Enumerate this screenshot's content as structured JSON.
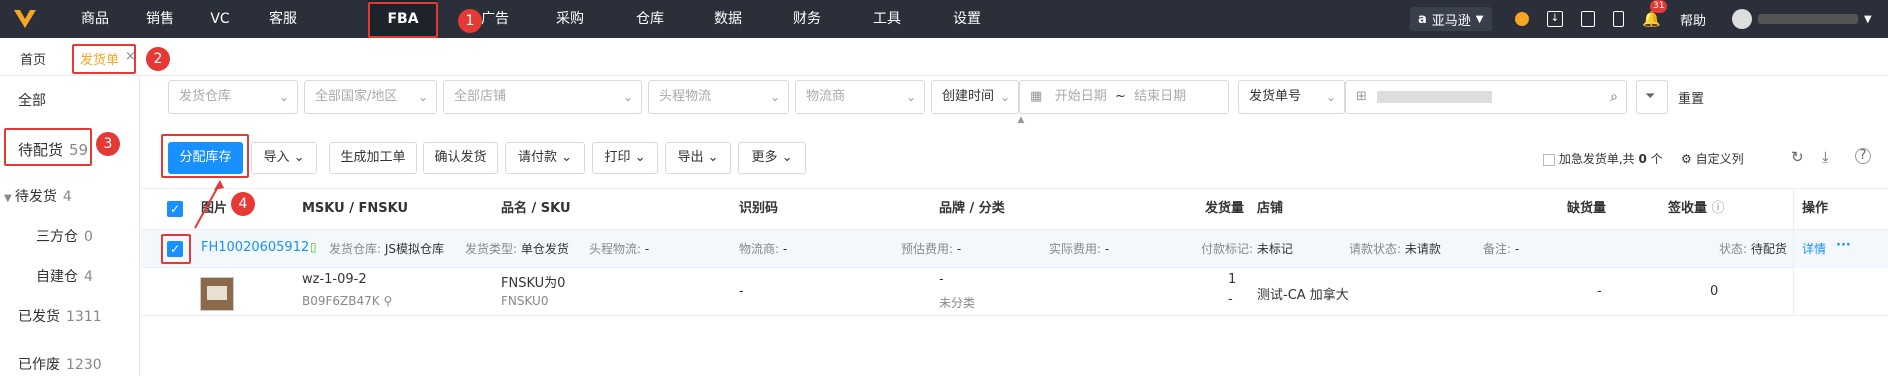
{
  "nav": {
    "items": [
      "商品",
      "销售",
      "VC",
      "客服",
      "FBA",
      "广告",
      "采购",
      "仓库",
      "数据",
      "财务",
      "工具",
      "设置"
    ],
    "active": "FBA"
  },
  "topright": {
    "store": "亚马逊",
    "help": "帮助",
    "badge": "31"
  },
  "markers": {
    "m1": "1",
    "m2": "2",
    "m3": "3",
    "m4": "4"
  },
  "tabs": {
    "home": "首页",
    "shipment": "发货单",
    "close": "×"
  },
  "sidebar": {
    "all": "全部",
    "pending": "待配货",
    "pending_count": "59",
    "toship": "待发货",
    "toship_count": "4",
    "third": "三方仓",
    "third_count": "0",
    "self": "自建仓",
    "self_count": "4",
    "shipped": "已发货",
    "shipped_count": "1311",
    "voided": "已作废",
    "voided_count": "1230"
  },
  "filters": {
    "warehouse": "发货仓库",
    "country": "全部国家/地区",
    "shop": "全部店铺",
    "logistics": "头程物流",
    "provider": "物流商",
    "time_type": "创建时间",
    "start": "开始日期",
    "tilde": "~",
    "end": "结束日期",
    "search_type": "发货单号",
    "reset": "重置"
  },
  "toolbar": {
    "allocate": "分配库存",
    "import": "导入",
    "gen_work": "生成加工单",
    "confirm": "确认发货",
    "request": "请付款",
    "print": "打印",
    "export": "导出",
    "more": "更多",
    "urgent": "加急发货单,共",
    "urgent_count": "0",
    "urgent_unit": "个",
    "custom_cols": "自定义列"
  },
  "table": {
    "headers": {
      "image": "图片",
      "msku": "MSKU / FNSKU",
      "name": "品名 / SKU",
      "code": "识别码",
      "brand": "品牌 / 分类",
      "qty": "发货量",
      "shop": "店铺",
      "short": "缺货量",
      "sign": "签收量",
      "ops": "操作"
    }
  },
  "order": {
    "id": "FH10020605912",
    "warehouse_label": "发货仓库:",
    "warehouse": "JS模拟仓库",
    "type_label": "发货类型:",
    "type": "单仓发货",
    "logistics_label": "头程物流:",
    "logistics": "-",
    "provider_label": "物流商:",
    "provider": "-",
    "est_label": "预估费用:",
    "est": "-",
    "actual_label": "实际费用:",
    "actual": "-",
    "paymark_label": "付款标记:",
    "paymark": "未标记",
    "request_label": "请款状态:",
    "request": "未请款",
    "note_label": "备注:",
    "note": "-",
    "status_label": "状态:",
    "status": "待配货",
    "detail": "详情",
    "more": "···"
  },
  "item": {
    "msku": "wz-1-09-2",
    "fnsku": "B09F6ZB47K",
    "name": "FNSKU为0",
    "sku": "FNSKU0",
    "code": "-",
    "brand": "-",
    "category": "未分类",
    "qty": "1",
    "qty2": "-",
    "shop": "测试-CA 加拿大",
    "short": "-",
    "sign": "0"
  }
}
